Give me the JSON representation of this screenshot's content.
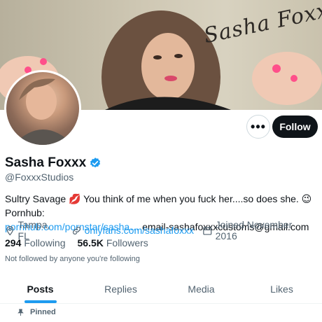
{
  "banner": {
    "signature": "Sasha Foxxx"
  },
  "profile": {
    "display_name": "Sasha Foxxx",
    "handle": "@FoxxxStudios",
    "bio_text": "Sultry Savage 💋 You think of me when you fuck her....so does she. 😉 Pornhub:",
    "bio_link": "pornhub.com/pornstar/sasha…",
    "bio_email": "email-sashafoxxxcustoms@gmail.com",
    "location": "Tampa, FL",
    "website": "onlyfans.com/sashafoxxx",
    "joined": "Joined November 2016",
    "following_count": "294",
    "following_label": "Following",
    "followers_count": "56.5K",
    "followers_label": "Followers",
    "not_followed_text": "Not followed by anyone you're following"
  },
  "actions": {
    "more_label": "•••",
    "follow_label": "Follow"
  },
  "tabs": [
    {
      "label": "Posts"
    },
    {
      "label": "Replies"
    },
    {
      "label": "Media"
    },
    {
      "label": "Likes"
    }
  ],
  "pinned_label": "Pinned",
  "colors": {
    "accent": "#1d9bf0",
    "text": "#0f1419",
    "muted": "#536471",
    "button_dark": "#0f1419"
  }
}
